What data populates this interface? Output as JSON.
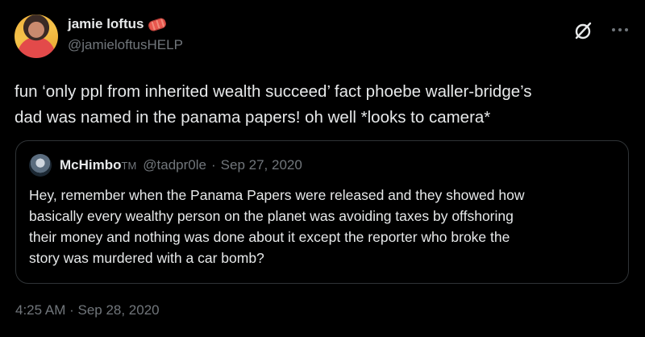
{
  "author": {
    "display_name": "jamie loftus",
    "name_emoji": "hot-dog-emoji",
    "handle": "@jamieloftusHELP"
  },
  "icons": {
    "grok": "grok-icon",
    "more": "more-icon"
  },
  "tweet": {
    "text": "fun ‘only ppl from inherited wealth succeed’ fact phoebe waller-bridge’s\ndad was named in the panama papers! oh well *looks to camera*",
    "timestamp": "4:25 AM · Sep 28, 2020"
  },
  "quote": {
    "display_name": "McHimbo",
    "name_suffix": "TM",
    "handle": "@tadpr0le",
    "separator": "·",
    "date": "Sep 27, 2020",
    "text": "Hey, remember when the Panama Papers were released and they showed how\nbasically every wealthy person on the planet was avoiding taxes by offshoring\ntheir money and nothing was done about it except the reporter who broke the\nstory was murdered with a car bomb?"
  },
  "colors": {
    "background": "#000000",
    "text_primary": "#e7e9ea",
    "text_secondary": "#71767b",
    "border": "#2f3336"
  }
}
